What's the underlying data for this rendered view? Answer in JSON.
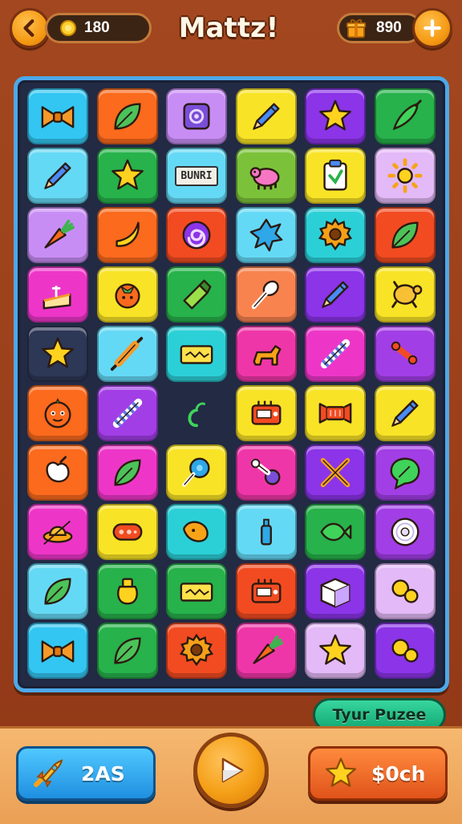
{
  "header": {
    "title": "Mattz!",
    "coins": "180",
    "gifts": "890",
    "back_icon": "chevron-left-icon",
    "plus_icon": "plus-icon",
    "coin_icon": "coin-icon",
    "gift_icon": "gift-icon"
  },
  "colors": {
    "blue": "#33c6f2",
    "orange": "#fb6a1d",
    "lavender": "#c88df5",
    "yellow": "#f9e326",
    "purple": "#8b34e8",
    "green": "#27b24b",
    "pink": "#ed36c8",
    "sky": "#64d9f5",
    "coral": "#f8834f",
    "navy": "#2d3756",
    "violet": "#a23ee6",
    "teal": "#2bd0d7",
    "magenta": "#ef36a8",
    "lilac": "#e3b9f7",
    "red": "#f24b21",
    "lime": "#7bc23a",
    "amber": "#f5b526",
    "accent_board": "#4ea8e8"
  },
  "board": {
    "rows": [
      [
        {
          "color": "blue",
          "icon": "bow-icon"
        },
        {
          "color": "orange",
          "icon": "leaf-icon"
        },
        {
          "color": "lavender",
          "icon": "snail-box-icon"
        },
        {
          "color": "yellow",
          "icon": "pencil-icon"
        },
        {
          "color": "purple",
          "icon": "star-icon"
        },
        {
          "color": "green",
          "icon": "chili-icon"
        }
      ],
      [
        {
          "color": "sky",
          "icon": "pencil-icon"
        },
        {
          "color": "green",
          "icon": "star-icon"
        },
        {
          "color": "sky",
          "icon": "text-tag-icon",
          "text": "BUNRI"
        },
        {
          "color": "lime",
          "icon": "pig-icon"
        },
        {
          "color": "yellow",
          "icon": "clipboard-icon"
        },
        {
          "color": "lilac",
          "icon": "sun-icon"
        }
      ],
      [
        {
          "color": "lavender",
          "icon": "carrot-icon"
        },
        {
          "color": "orange",
          "icon": "banana-icon"
        },
        {
          "color": "red",
          "icon": "swirl-icon"
        },
        {
          "color": "sky",
          "icon": "splat-icon"
        },
        {
          "color": "teal",
          "icon": "gear-icon"
        },
        {
          "color": "red",
          "icon": "leaf-icon"
        }
      ],
      [
        {
          "color": "pink",
          "icon": "cake-icon"
        },
        {
          "color": "yellow",
          "icon": "tomato-icon"
        },
        {
          "color": "green",
          "icon": "battery-icon"
        },
        {
          "color": "coral",
          "icon": "spoon-icon"
        },
        {
          "color": "purple",
          "icon": "pencil-icon"
        },
        {
          "color": "yellow",
          "icon": "turtle-icon"
        }
      ],
      [
        {
          "color": "navy",
          "icon": "star-icon"
        },
        {
          "color": "sky",
          "icon": "rolling-pin-icon"
        },
        {
          "color": "teal",
          "icon": "ticket-icon"
        },
        {
          "color": "magenta",
          "icon": "dog-icon"
        },
        {
          "color": "pink",
          "icon": "stick-icon"
        },
        {
          "color": "violet",
          "icon": "bone-icon"
        }
      ],
      [
        {
          "color": "orange",
          "icon": "face-icon"
        },
        {
          "color": "violet",
          "icon": "stick-icon"
        },
        {
          "color": "empty",
          "icon": "sprout-icon"
        },
        {
          "color": "yellow",
          "icon": "radio-icon"
        },
        {
          "color": "yellow",
          "icon": "candy-icon"
        },
        {
          "color": "yellow",
          "icon": "pencil-icon"
        }
      ],
      [
        {
          "color": "orange",
          "icon": "bag-icon"
        },
        {
          "color": "pink",
          "icon": "leaf-icon"
        },
        {
          "color": "yellow",
          "icon": "lollipop-icon"
        },
        {
          "color": "magenta",
          "icon": "rattle-icon"
        },
        {
          "color": "purple",
          "icon": "swords-icon"
        },
        {
          "color": "violet",
          "icon": "speech-leaf-icon"
        }
      ],
      [
        {
          "color": "pink",
          "icon": "hat-icon"
        },
        {
          "color": "yellow",
          "icon": "capsule-icon"
        },
        {
          "color": "teal",
          "icon": "bean-icon"
        },
        {
          "color": "sky",
          "icon": "bottle-icon"
        },
        {
          "color": "green",
          "icon": "fish-icon"
        },
        {
          "color": "violet",
          "icon": "disc-icon"
        }
      ],
      [
        {
          "color": "sky",
          "icon": "leaf-icon"
        },
        {
          "color": "green",
          "icon": "jar-icon"
        },
        {
          "color": "green",
          "icon": "ticket-icon"
        },
        {
          "color": "red",
          "icon": "radio-icon"
        },
        {
          "color": "purple",
          "icon": "box-icon"
        },
        {
          "color": "lilac",
          "icon": "bubbles-icon"
        }
      ],
      [
        {
          "color": "blue",
          "icon": "bow-icon"
        },
        {
          "color": "green",
          "icon": "leaf-icon"
        },
        {
          "color": "red",
          "icon": "gear-icon"
        },
        {
          "color": "magenta",
          "icon": "carrot-icon"
        },
        {
          "color": "lilac",
          "icon": "star-icon"
        },
        {
          "color": "purple",
          "icon": "bubbles-icon"
        }
      ]
    ]
  },
  "footer": {
    "puzzle_label": "Tyur Puzee",
    "score_label": "2AS",
    "score_icon": "rocket-icon",
    "play_icon": "play-icon",
    "search_label": "$0ch",
    "search_icon": "star-icon"
  }
}
